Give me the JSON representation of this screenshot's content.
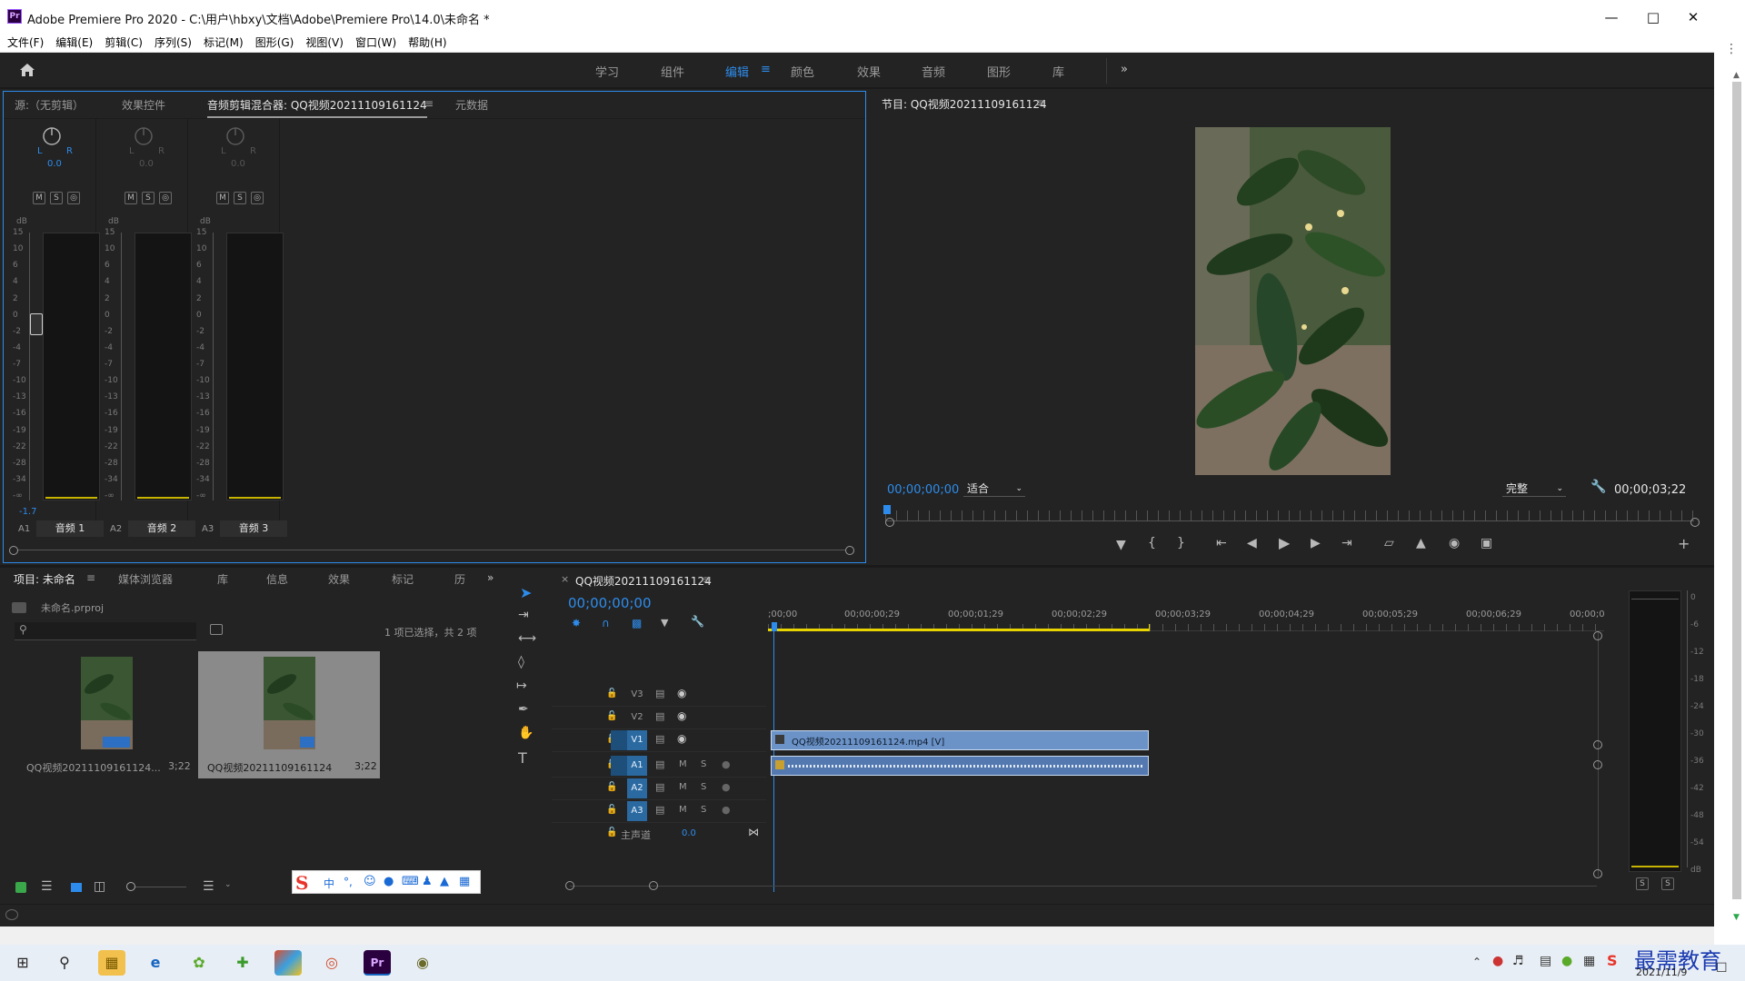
{
  "window": {
    "title": "Adobe Premiere Pro 2020 - C:\\用户\\hbxy\\文档\\Adobe\\Premiere Pro\\14.0\\未命名 *",
    "logo": "Pr"
  },
  "menu": [
    "文件(F)",
    "编辑(E)",
    "剪辑(C)",
    "序列(S)",
    "标记(M)",
    "图形(G)",
    "视图(V)",
    "窗口(W)",
    "帮助(H)"
  ],
  "workspaces": {
    "items": [
      "学习",
      "组件",
      "编辑",
      "颜色",
      "效果",
      "音频",
      "图形",
      "库"
    ],
    "active": "编辑",
    "menu_glyph": "≡",
    "more": "»"
  },
  "source_panel": {
    "tabs": [
      "源:（无剪辑）",
      "效果控件",
      "音频剪辑混合器: QQ视频20211109161124",
      "元数据"
    ],
    "active_tab": "音频剪辑混合器: QQ视频20211109161124",
    "tab_menu": "≡",
    "channels": [
      {
        "pan_l": "L",
        "pan_r": "R",
        "pan_value": "0.0",
        "id": "A1",
        "name": "音频 1",
        "peak": "-1.7"
      },
      {
        "pan_l": "L",
        "pan_r": "R",
        "pan_value": "0.0",
        "id": "A2",
        "name": "音频 2",
        "peak": ""
      },
      {
        "pan_l": "L",
        "pan_r": "R",
        "pan_value": "0.0",
        "id": "A3",
        "name": "音频 3",
        "peak": ""
      }
    ],
    "msr": [
      "M",
      "S",
      "◎"
    ],
    "db_unit": "dB",
    "db_ticks": [
      "15",
      "10",
      "6",
      "4",
      "2",
      "0",
      "-2",
      "-4",
      "-7",
      "-10",
      "-13",
      "-16",
      "-19",
      "-22",
      "-28",
      "-34",
      "-∞"
    ]
  },
  "program_monitor": {
    "title": "节目: QQ视频20211109161124",
    "title_menu": "≡",
    "timecode": "00;00;00;00",
    "fit": "适合",
    "quality": "完整",
    "duration": "00;00;03;22"
  },
  "project_panel": {
    "tabs": [
      "项目: 未命名",
      "媒体浏览器",
      "库",
      "信息",
      "效果",
      "标记",
      "历"
    ],
    "tab_menu": "≡",
    "more": "»",
    "file": "未命名.prproj",
    "selection": "1 项已选择，共 2 项",
    "items": [
      {
        "name": "QQ视频20211109161124...",
        "duration": "3;22",
        "selected": false
      },
      {
        "name": "QQ视频20211109161124",
        "duration": "3;22",
        "selected": true
      }
    ]
  },
  "ime_bar": {
    "logo": "S",
    "mode": "中"
  },
  "timeline": {
    "tab_name": "QQ视频20211109161124",
    "tab_close": "×",
    "tab_menu": "≡",
    "timecode": "00;00;00;00",
    "ruler": [
      ";00;00",
      "00;00;00;29",
      "00;00;01;29",
      "00;00;02;29",
      "00;00;03;29",
      "00;00;04;29",
      "00;00;05;29",
      "00;00;06;29",
      "00;00;0"
    ],
    "video_tracks": [
      "V3",
      "V2",
      "V1"
    ],
    "audio_tracks": [
      "A1",
      "A2",
      "A3"
    ],
    "track_m": "M",
    "track_s": "S",
    "master": {
      "label": "主声道",
      "value": "0.0"
    },
    "video_clip": "QQ视频20211109161124.mp4 [V]",
    "end_fraction": 0.455
  },
  "audio_meter": {
    "ticks": [
      "0",
      "-6",
      "-12",
      "-18",
      "-24",
      "-30",
      "-36",
      "-42",
      "-48",
      "-54",
      "dB"
    ],
    "solo_labels": [
      "S",
      "S"
    ]
  },
  "taskbar": {
    "date": "2021/11/9",
    "watermark": "最需教育"
  },
  "colors": {
    "accent": "#2d8ceb",
    "panel": "#232323",
    "clip_video": "#6b93c8",
    "clip_audio": "#5479b0",
    "work_area": "#e8d400"
  }
}
